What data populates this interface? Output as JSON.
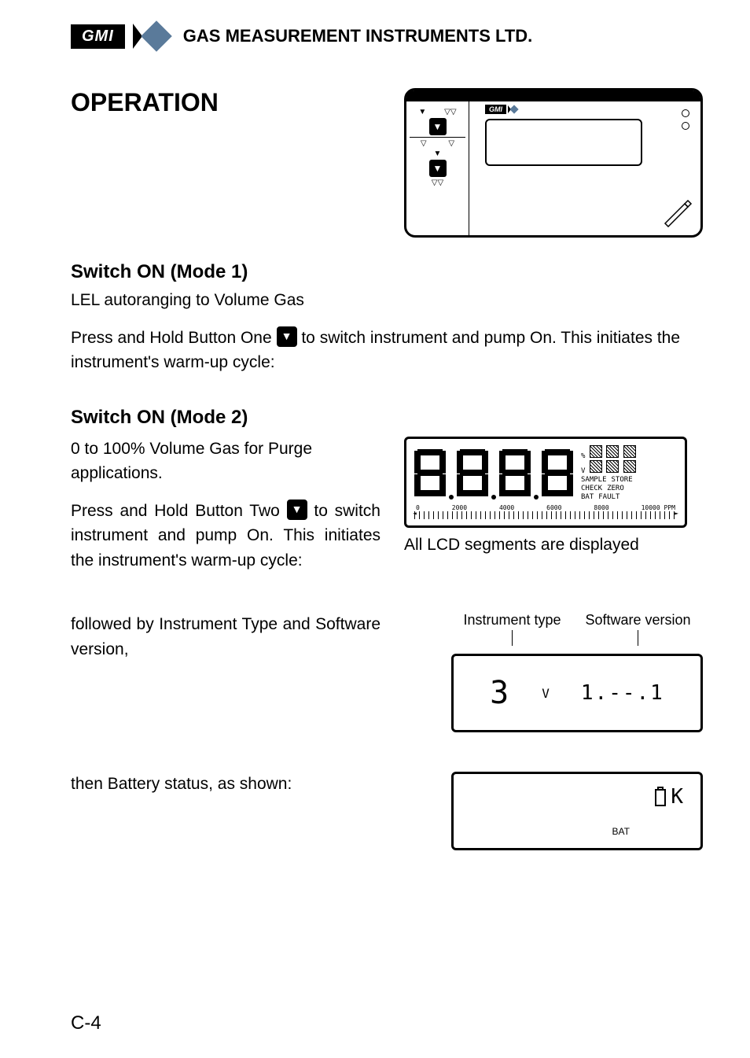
{
  "header": {
    "logo_text": "GMI",
    "company": "GAS MEASUREMENT INSTRUMENTS LTD."
  },
  "title": "OPERATION",
  "sections": {
    "mode1": {
      "heading": "Switch ON (Mode 1)",
      "subtitle": "LEL autoranging to Volume Gas",
      "text_before_btn": "Press and Hold Button One ",
      "text_after_btn": " to switch instrument and pump On. This initiates the instrument's warm-up cycle:"
    },
    "mode2": {
      "heading": "Switch ON (Mode 2)",
      "subtitle": "0 to 100% Volume Gas for Purge applications.",
      "text_before_btn": "Press and Hold Button Two ",
      "text_after_btn": " to switch instrument and pump On. This initiates the instrument's warm-up cycle:"
    },
    "lcd_caption": "All LCD segments are displayed",
    "lcd_side_labels": {
      "pct": "%",
      "v": "V",
      "sample": "SAMPLE",
      "store": "STORE",
      "check": "CHECK",
      "zero": "ZERO",
      "bat": "BAT",
      "fault": "FAULT"
    },
    "lcd_scale": [
      "0",
      "2000",
      "4000",
      "6000",
      "8000",
      "10000 PPM"
    ],
    "followed_text": "followed by Instrument Type and Software version,",
    "info_labels": {
      "left": "Instrument type",
      "right": "Software version"
    },
    "info_values": {
      "type": "3",
      "v_prefix": "V",
      "version": "1.--.1"
    },
    "battery_text": "then Battery status, as shown:",
    "battery_display": {
      "ok": "K",
      "bat": "BAT"
    }
  },
  "page_number": "C-4"
}
